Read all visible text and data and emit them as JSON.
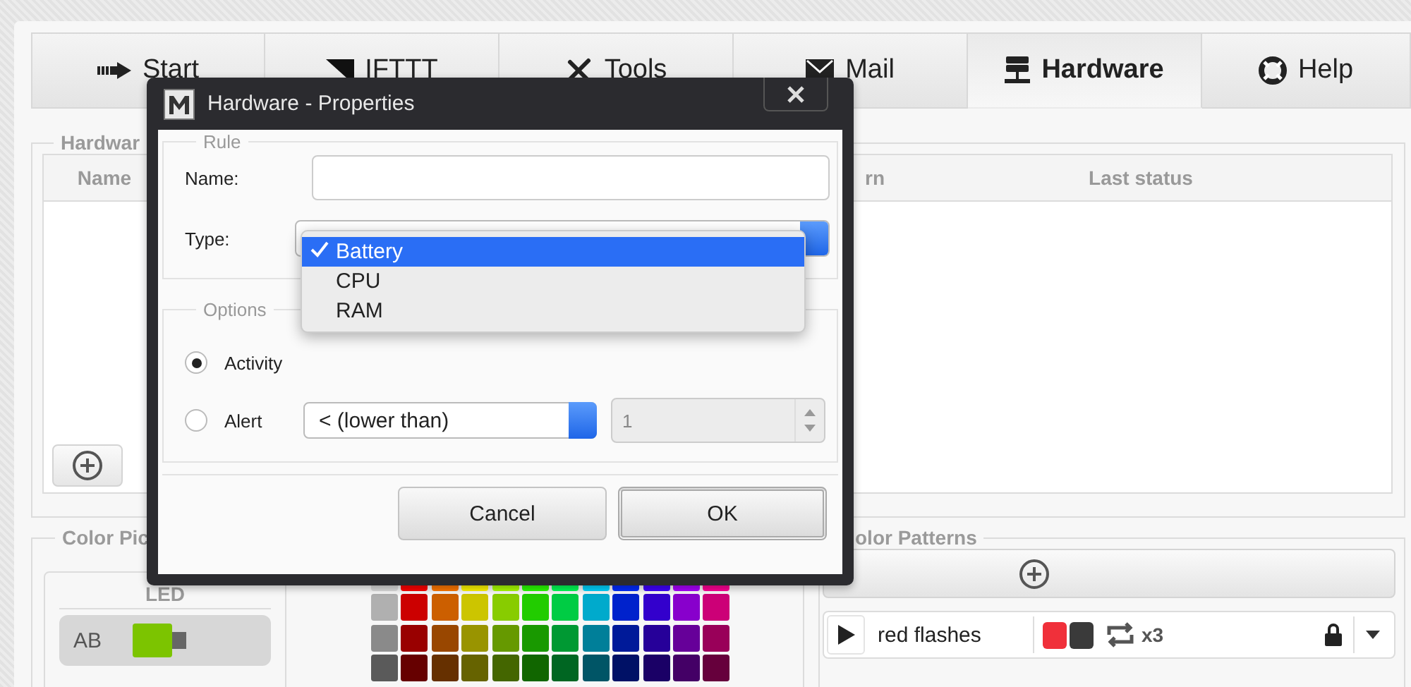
{
  "tabs": [
    {
      "label": "Start",
      "kind": "arrow",
      "selected": false
    },
    {
      "label": "IFTTT",
      "kind": "wedge",
      "selected": false
    },
    {
      "label": "Tools",
      "kind": "tools",
      "selected": false
    },
    {
      "label": "Mail",
      "kind": "mail",
      "selected": false
    },
    {
      "label": "Hardware",
      "kind": "server",
      "selected": true
    },
    {
      "label": "Help",
      "kind": "lifebuoy",
      "selected": false
    }
  ],
  "hardware_panel": {
    "legend": "Hardwar",
    "table": {
      "columns": [
        "Name",
        "rn",
        "Last status"
      ]
    }
  },
  "color_picker": {
    "legend": "Color Pic",
    "led_list": {
      "header": "LED",
      "items": [
        {
          "label": "AB",
          "selected": true,
          "color": "#7cc400"
        }
      ]
    }
  },
  "color_patterns": {
    "legend": "olor Patterns",
    "patterns": [
      {
        "name": "red flashes",
        "swatches": [
          {
            "color": "#f0303a"
          },
          {
            "color": "#3a3a3a"
          }
        ],
        "repeat": "x3",
        "locked": true
      }
    ]
  },
  "dialog": {
    "title": "Hardware - Properties",
    "rule": {
      "legend": "Rule",
      "name_label": "Name:",
      "type_label": "Type:",
      "type_menu": [
        {
          "label": "Battery",
          "selected": true
        },
        {
          "label": "CPU",
          "selected": false
        },
        {
          "label": "RAM",
          "selected": false
        }
      ]
    },
    "options": {
      "legend": "Options",
      "choices": [
        {
          "label": "Activity",
          "selected": true
        },
        {
          "label": "Alert",
          "selected": false
        }
      ],
      "comparator": "< (lower than)",
      "threshold": {
        "value": "1",
        "disabled": true
      }
    },
    "buttons": [
      {
        "label": "Cancel",
        "default": false
      },
      {
        "label": "OK",
        "default": true
      }
    ]
  }
}
